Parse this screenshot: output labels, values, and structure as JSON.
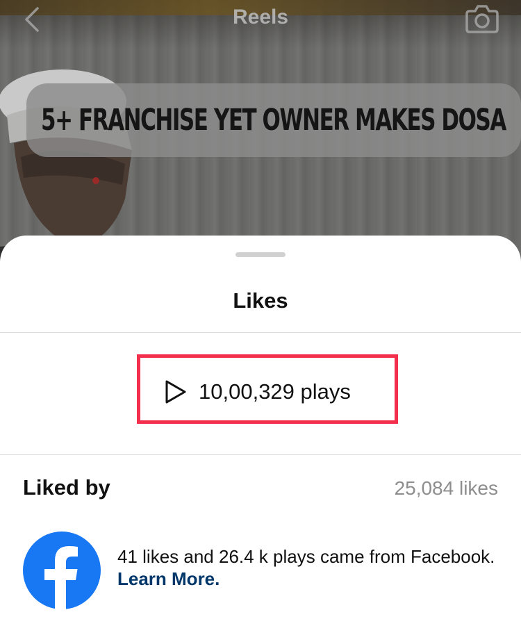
{
  "header": {
    "title": "Reels",
    "back_icon": "chevron-left-icon",
    "camera_icon": "camera-icon"
  },
  "video": {
    "caption": "5+ FRANCHISE YET OWNER MAKES DOSA"
  },
  "sheet": {
    "title": "Likes",
    "plays_label": "10,00,329 plays",
    "play_icon": "play-icon",
    "highlight_color": "#f2304e",
    "liked_by_label": "Liked by",
    "likes_count": "25,084 likes",
    "facebook": {
      "icon": "facebook-logo-icon",
      "text": "41 likes and 26.4 k plays came from Facebook.",
      "link": "Learn More.",
      "brand_color": "#1877f2",
      "link_color": "#00376b"
    }
  }
}
